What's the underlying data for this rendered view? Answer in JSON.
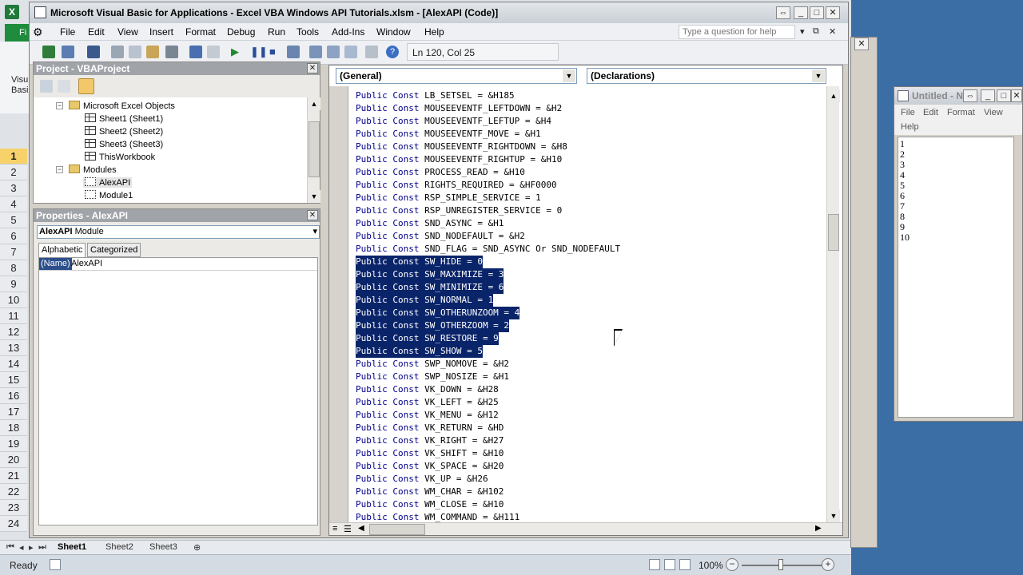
{
  "excel": {
    "file_tab": "Fi",
    "ribbon_lines": [
      "Visu",
      "Basi"
    ],
    "rows": [
      "1",
      "2",
      "3",
      "4",
      "5",
      "6",
      "7",
      "8",
      "9",
      "10",
      "11",
      "12",
      "13",
      "14",
      "15",
      "16",
      "17",
      "18",
      "19",
      "20",
      "21",
      "22",
      "23",
      "24"
    ],
    "sheet_tabs": [
      "Sheet1",
      "Sheet2",
      "Sheet3"
    ],
    "status": "Ready",
    "zoom": "100%"
  },
  "vbe": {
    "title": "Microsoft Visual Basic for Applications - Excel VBA Windows API Tutorials.xlsm - [AlexAPI (Code)]",
    "menu": [
      "File",
      "Edit",
      "View",
      "Insert",
      "Format",
      "Debug",
      "Run",
      "Tools",
      "Add-Ins",
      "Window",
      "Help"
    ],
    "help_placeholder": "Type a question for help",
    "position": "Ln 120, Col 25",
    "project_title": "Project - VBAProject",
    "tree": {
      "folder1": "Microsoft Excel Objects",
      "sheet1": "Sheet1 (Sheet1)",
      "sheet2": "Sheet2 (Sheet2)",
      "sheet3": "Sheet3 (Sheet3)",
      "workbook": "ThisWorkbook",
      "folder2": "Modules",
      "mod1": "AlexAPI",
      "mod2": "Module1"
    },
    "properties_title": "Properties - AlexAPI",
    "properties_object": "AlexAPI",
    "properties_type": "Module",
    "prop_tabs": [
      "Alphabetic",
      "Categorized"
    ],
    "prop_name_label": "(Name)",
    "prop_name_value": "AlexAPI",
    "general_combo": "(General)",
    "decl_combo": "(Declarations)",
    "code_lines": [
      {
        "kw": "Public Const ",
        "rest": "LB_SETSEL = &H185",
        "sel": false
      },
      {
        "kw": "Public Const ",
        "rest": "MOUSEEVENTF_LEFTDOWN = &H2",
        "sel": false
      },
      {
        "kw": "Public Const ",
        "rest": "MOUSEEVENTF_LEFTUP = &H4",
        "sel": false
      },
      {
        "kw": "Public Const ",
        "rest": "MOUSEEVENTF_MOVE = &H1",
        "sel": false
      },
      {
        "kw": "Public Const ",
        "rest": "MOUSEEVENTF_RIGHTDOWN = &H8",
        "sel": false
      },
      {
        "kw": "Public Const ",
        "rest": "MOUSEEVENTF_RIGHTUP = &H10",
        "sel": false
      },
      {
        "kw": "Public Const ",
        "rest": "PROCESS_READ = &H10",
        "sel": false
      },
      {
        "kw": "Public Const ",
        "rest": "RIGHTS_REQUIRED = &HF0000",
        "sel": false
      },
      {
        "kw": "Public Const ",
        "rest": "RSP_SIMPLE_SERVICE = 1",
        "sel": false
      },
      {
        "kw": "Public Const ",
        "rest": "RSP_UNREGISTER_SERVICE = 0",
        "sel": false
      },
      {
        "kw": "Public Const ",
        "rest": "SND_ASYNC = &H1",
        "sel": false
      },
      {
        "kw": "Public Const ",
        "rest": "SND_NODEFAULT = &H2",
        "sel": false
      },
      {
        "kw": "Public Const ",
        "rest": "SND_FLAG = SND_ASYNC Or SND_NODEFAULT",
        "sel": false
      },
      {
        "kw": "Public Const ",
        "rest": "SW_HIDE = 0",
        "sel": true
      },
      {
        "kw": "Public Const ",
        "rest": "SW_MAXIMIZE = 3",
        "sel": true
      },
      {
        "kw": "Public Const ",
        "rest": "SW_MINIMIZE = 6",
        "sel": true
      },
      {
        "kw": "Public Const ",
        "rest": "SW_NORMAL = 1",
        "sel": true
      },
      {
        "kw": "Public Const ",
        "rest": "SW_OTHERUNZOOM = 4",
        "sel": true
      },
      {
        "kw": "Public Const ",
        "rest": "SW_OTHERZOOM = 2",
        "sel": true
      },
      {
        "kw": "Public Const ",
        "rest": "SW_RESTORE = 9",
        "sel": true
      },
      {
        "kw": "Public Const ",
        "rest": "SW_SHOW = 5",
        "sel": true
      },
      {
        "kw": "Public Const ",
        "rest": "SWP_NOMOVE = &H2",
        "sel": false
      },
      {
        "kw": "Public Const ",
        "rest": "SWP_NOSIZE = &H1",
        "sel": false
      },
      {
        "kw": "Public Const ",
        "rest": "VK_DOWN = &H28",
        "sel": false
      },
      {
        "kw": "Public Const ",
        "rest": "VK_LEFT = &H25",
        "sel": false
      },
      {
        "kw": "Public Const ",
        "rest": "VK_MENU = &H12",
        "sel": false
      },
      {
        "kw": "Public Const ",
        "rest": "VK_RETURN = &HD",
        "sel": false
      },
      {
        "kw": "Public Const ",
        "rest": "VK_RIGHT = &H27",
        "sel": false
      },
      {
        "kw": "Public Const ",
        "rest": "VK_SHIFT = &H10",
        "sel": false
      },
      {
        "kw": "Public Const ",
        "rest": "VK_SPACE = &H20",
        "sel": false
      },
      {
        "kw": "Public Const ",
        "rest": "VK_UP = &H26",
        "sel": false
      },
      {
        "kw": "Public Const ",
        "rest": "WM_CHAR = &H102",
        "sel": false
      },
      {
        "kw": "Public Const ",
        "rest": "WM_CLOSE = &H10",
        "sel": false
      },
      {
        "kw": "Public Const ",
        "rest": "WM_COMMAND = &H111",
        "sel": false
      }
    ]
  },
  "notepad": {
    "title": "Untitled - N",
    "menu": [
      "File",
      "Edit",
      "Format",
      "View",
      "Help"
    ],
    "lines": [
      "1",
      "2",
      "3",
      "4",
      "5",
      "6",
      "7",
      "8",
      "9",
      "10"
    ]
  },
  "colors": {
    "selection": "#0a246a",
    "keyword": "#00008b",
    "desktop": "#3a6ea5"
  }
}
